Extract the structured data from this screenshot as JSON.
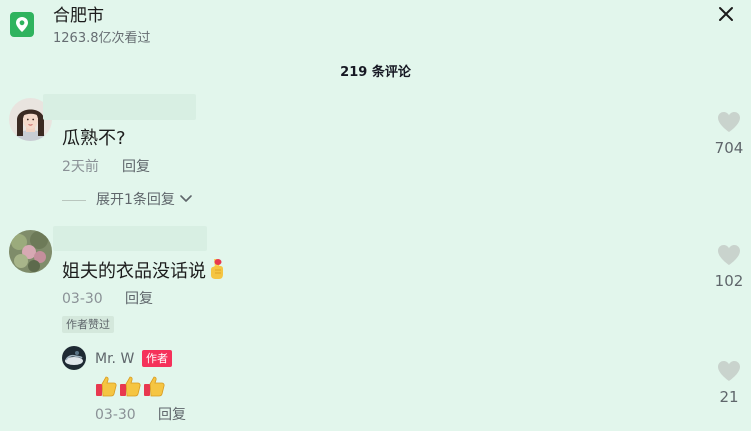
{
  "location": {
    "name": "合肥市",
    "views": "1263.8亿次看过"
  },
  "comments_header": {
    "count_label": "219 条评论"
  },
  "comments": [
    {
      "text": "瓜熟不?",
      "time": "2天前",
      "reply_label": "回复",
      "expand_label": "展开1条回复",
      "like_count": "704"
    },
    {
      "text": "姐夫的衣品没话说",
      "time": "03-30",
      "reply_label": "回复",
      "badge": "作者赞过",
      "like_count": "102",
      "reply": {
        "name": "Mr. W",
        "badge": "作者",
        "time": "03-30",
        "reply_label": "回复",
        "like_count": "21"
      }
    }
  ],
  "colors": {
    "background": "#e2f6ec",
    "accent_green": "#2fb35e",
    "author_badge": "#f5315a",
    "heart": "#c9d3cd"
  },
  "icons": [
    "location-pin-icon",
    "close-icon",
    "heart-icon",
    "chevron-down-icon",
    "fingers-crossed-emoji",
    "thumbs-up-emoji"
  ]
}
